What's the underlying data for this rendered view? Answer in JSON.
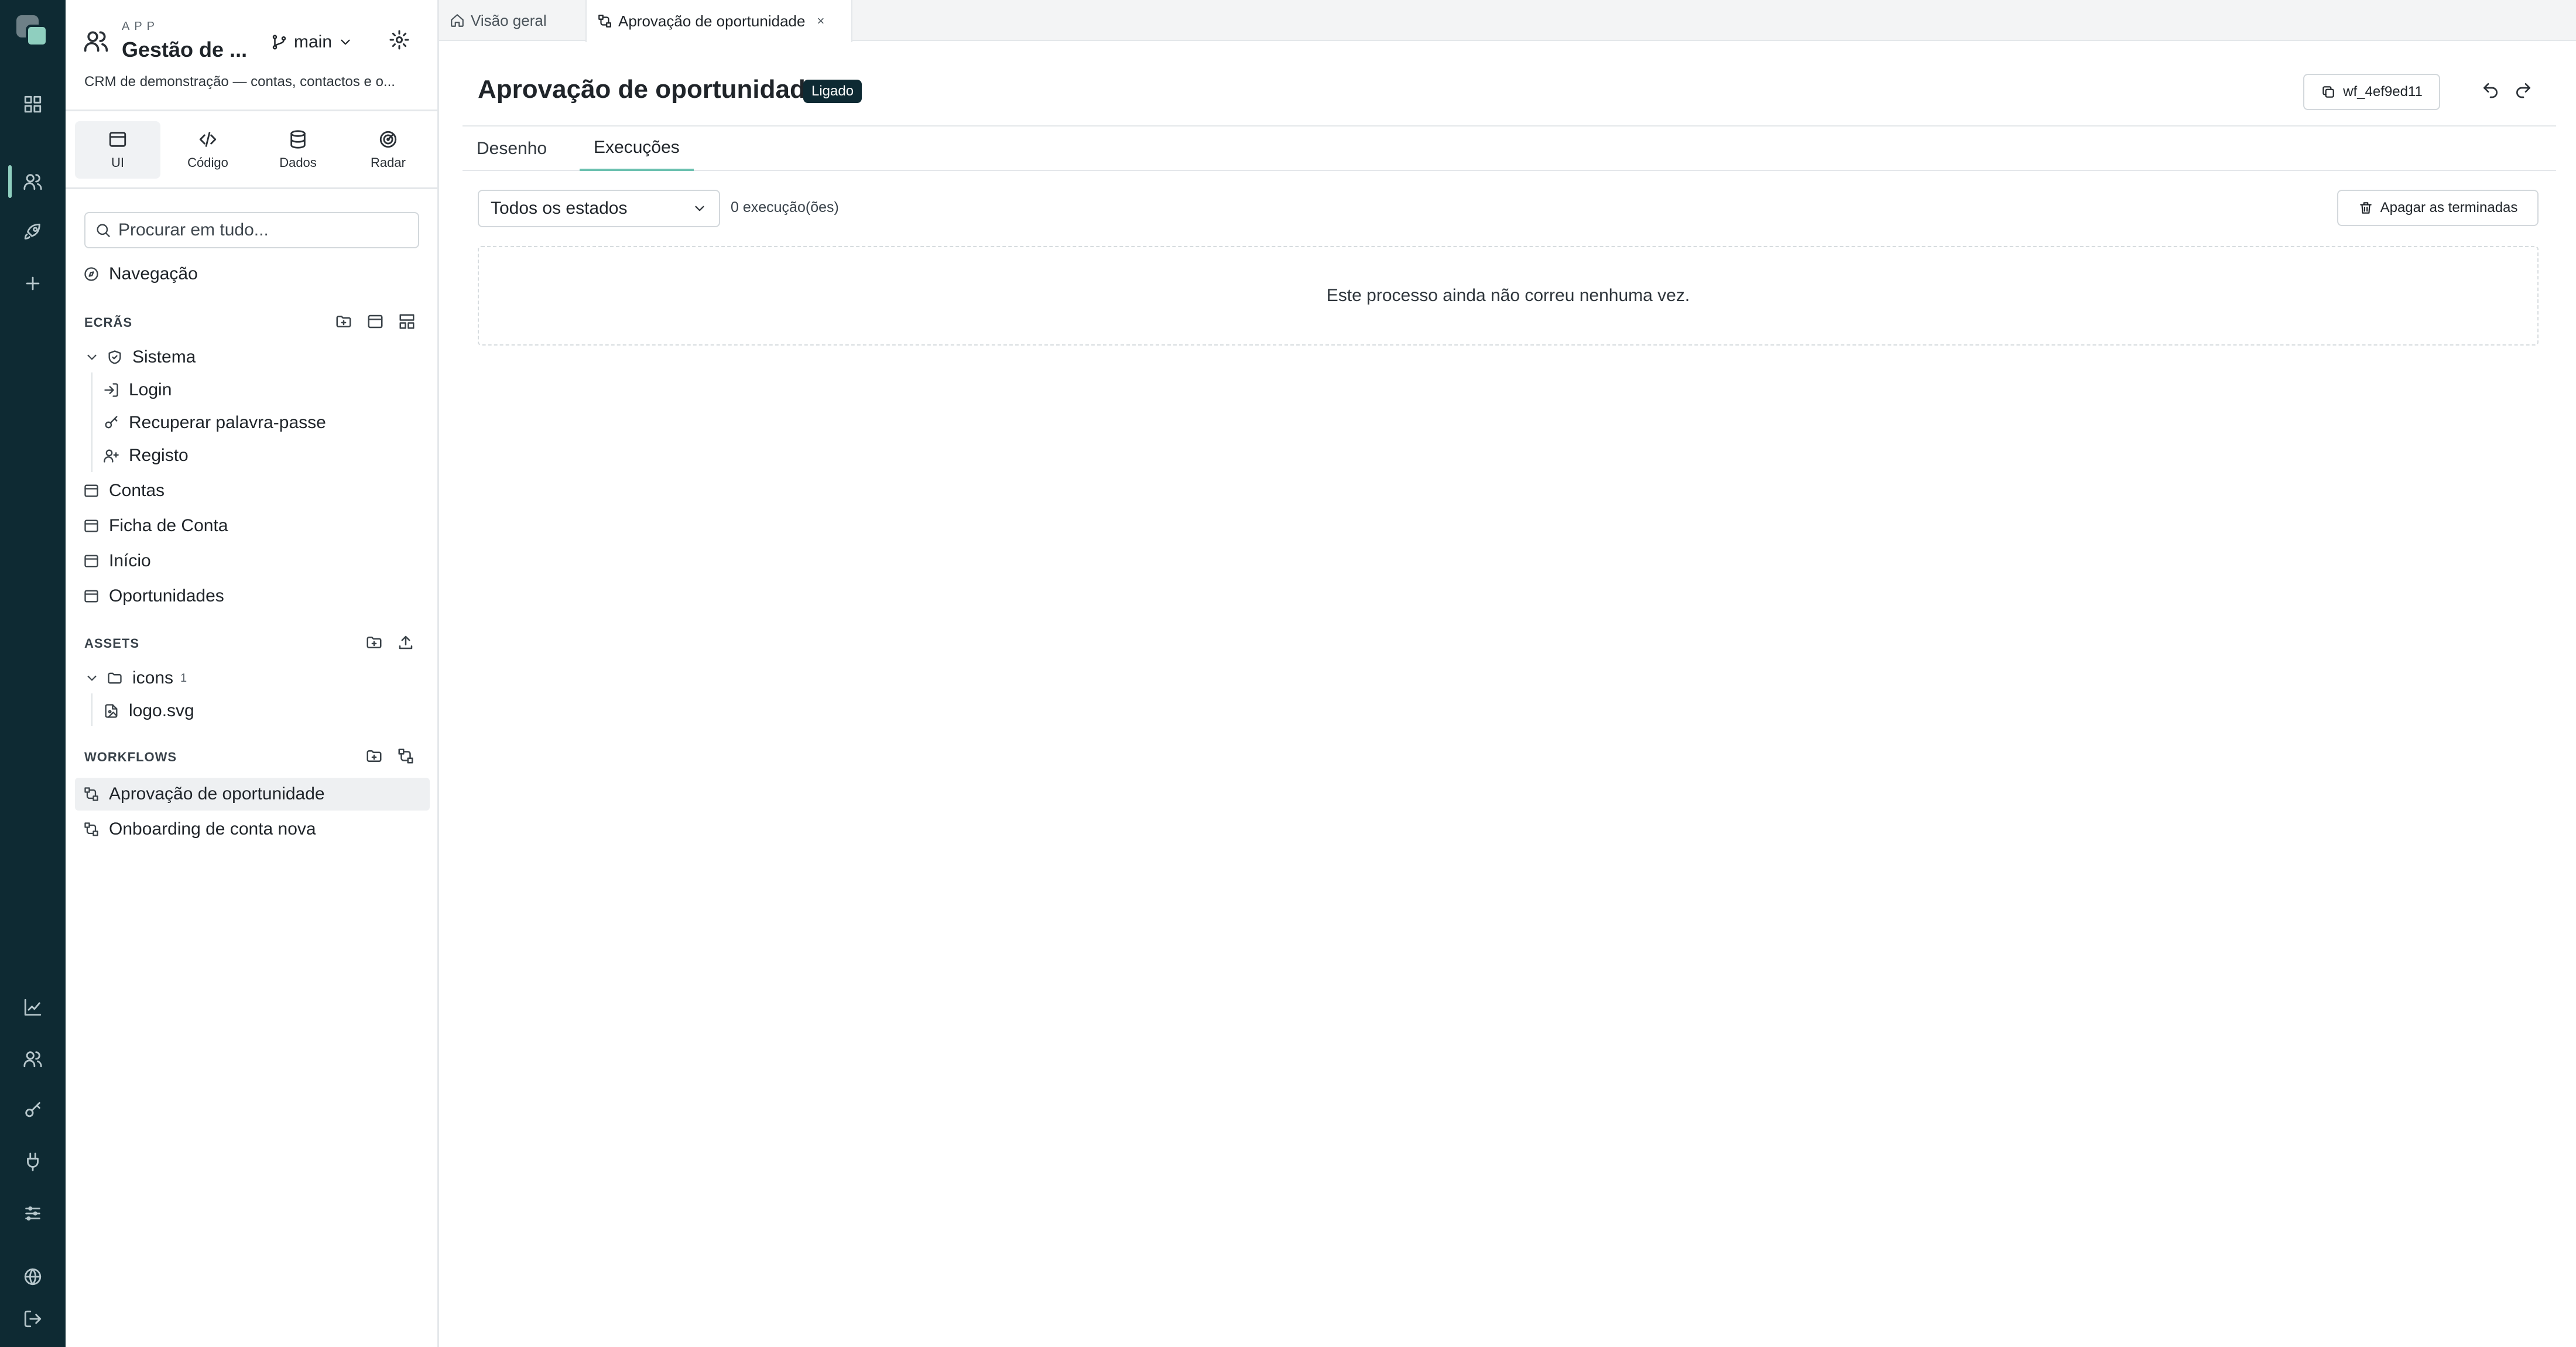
{
  "app": {
    "kicker": "APP",
    "title": "Gestão de ...",
    "branch": "main",
    "description": "CRM de demonstração — contas, contactos e o..."
  },
  "modes": [
    {
      "label": "UI",
      "icon": "window-icon"
    },
    {
      "label": "Código",
      "icon": "code-icon"
    },
    {
      "label": "Dados",
      "icon": "database-icon"
    },
    {
      "label": "Radar",
      "icon": "radar-icon"
    }
  ],
  "search": {
    "placeholder": "Procurar em tudo..."
  },
  "nav": {
    "label": "Navegação"
  },
  "screens": {
    "section_label": "ECRÃS",
    "folder": "Sistema",
    "system_items": [
      "Login",
      "Recuperar palavra-passe",
      "Registo"
    ],
    "items": [
      "Contas",
      "Ficha de Conta",
      "Início",
      "Oportunidades"
    ]
  },
  "assets": {
    "section_label": "ASSETS",
    "folder": "icons",
    "folder_count": "1",
    "files": [
      "logo.svg"
    ]
  },
  "workflows": {
    "section_label": "WORKFLOWS",
    "items": [
      "Aprovação de oportunidade",
      "Onboarding de conta nova"
    ],
    "active_index": 0
  },
  "tabs": [
    {
      "label": "Visão geral",
      "icon": "home-icon",
      "active": false
    },
    {
      "label": "Aprovação de oportunidade",
      "icon": "workflow-icon",
      "active": true,
      "close": "×"
    }
  ],
  "page": {
    "title": "Aprovação de oportunidade",
    "status": "Ligado",
    "id_label": "wf_4ef9ed11"
  },
  "sub_tabs": [
    {
      "label": "Desenho",
      "active": false
    },
    {
      "label": "Execuções",
      "active": true
    }
  ],
  "executions": {
    "filter_value": "Todos os estados",
    "count_text": "0 execução(ões)",
    "delete_label": "Apagar as terminadas",
    "empty_text": "Este processo ainda não correu nenhuma vez."
  },
  "colors": {
    "rail_bg": "#0e2a33",
    "accent": "#8fcfbf",
    "tab_underline": "#6cc1b0",
    "badge_bg": "#0e2a33"
  }
}
